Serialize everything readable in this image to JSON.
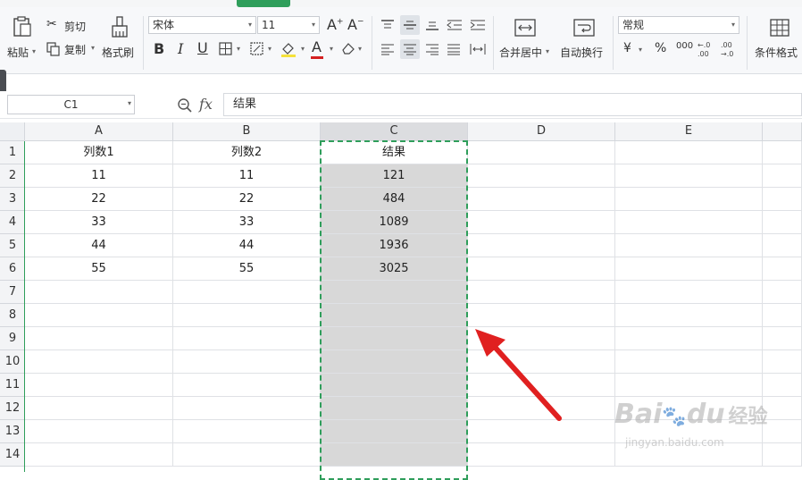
{
  "ribbon": {
    "paste_label": "粘贴",
    "cut_label": "剪切",
    "copy_label": "复制",
    "format_painter_label": "格式刷",
    "font_name": "宋体",
    "font_size": "11",
    "merge_center_label": "合并居中",
    "wrap_text_label": "自动换行",
    "number_format": "常规",
    "currency_symbol": "¥",
    "percent_symbol": "%",
    "thousands_symbol": "000",
    "conditional_format_label": "条件格式"
  },
  "formula_bar": {
    "name_box": "C1",
    "fx_label": "fx",
    "content": "结果"
  },
  "sheet": {
    "columns": [
      "A",
      "B",
      "C",
      "D",
      "E"
    ],
    "rows": [
      "1",
      "2",
      "3",
      "4",
      "5",
      "6",
      "7",
      "8",
      "9",
      "10",
      "11",
      "12",
      "13",
      "14"
    ],
    "data": [
      [
        "列数1",
        "列数2",
        "结果"
      ],
      [
        "11",
        "11",
        "121"
      ],
      [
        "22",
        "22",
        "484"
      ],
      [
        "33",
        "33",
        "1089"
      ],
      [
        "44",
        "44",
        "1936"
      ],
      [
        "55",
        "55",
        "3025"
      ]
    ],
    "selected_column": "C",
    "selection_color": "#2f9e5b",
    "arrow_color": "#e02020"
  },
  "watermark": {
    "brand": "Bai",
    "brand2": "du",
    "cn": "经验",
    "url": "jingyan.baidu.com"
  }
}
